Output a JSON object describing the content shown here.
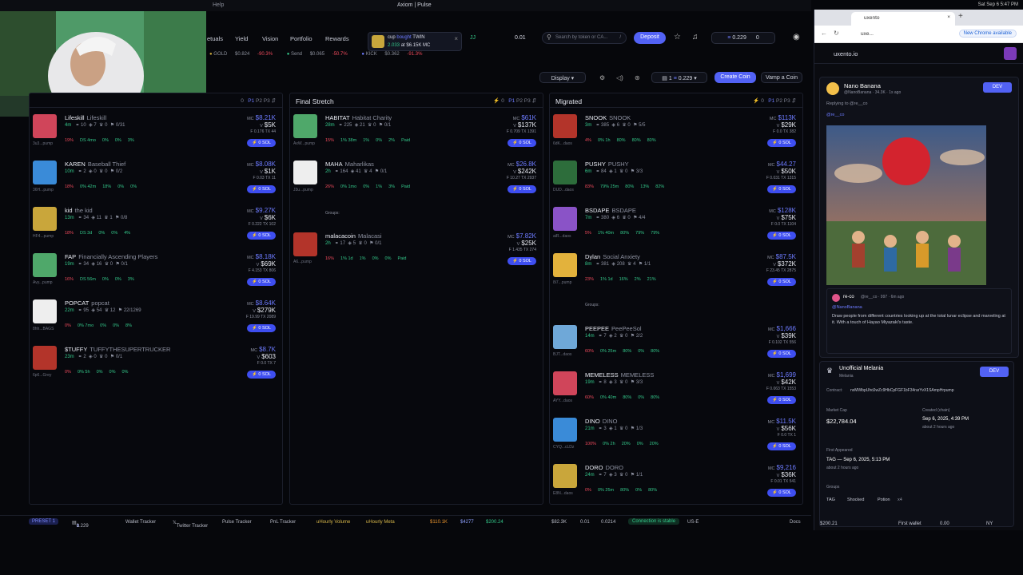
{
  "window": {
    "help": "Help",
    "title": "Axiom | Pulse"
  },
  "nav": {
    "links": [
      "etuals",
      "Yield",
      "Vision",
      "Portfolio",
      "Rewards"
    ],
    "notif": {
      "user": "cup",
      "action": "bought",
      "token": "TWIN",
      "amount": "2.033",
      "at": "at",
      "mc": "$6.15K MC"
    },
    "jj": "JJ",
    "jj_val": "0.01",
    "search_placeholder": "Search by token or CA...",
    "search_key": "/",
    "deposit": "Deposit",
    "wallet_val": "0.229",
    "wallet_count": "0"
  },
  "ticker": [
    {
      "name": "GOLD",
      "price": "$0.824",
      "chg": "-90.3%"
    },
    {
      "name": "Send",
      "price": "$0.065",
      "chg": "-50.7%"
    },
    {
      "name": "KICK",
      "price": "$0.362",
      "chg": "-91.3%"
    }
  ],
  "toolbar": {
    "display": "Display",
    "wallet_count": "1",
    "wallet_val": "0.229",
    "create": "Create Coin",
    "vamp": "Vamp a Coin"
  },
  "columns": {
    "left": {
      "filters": [
        "0",
        "P1",
        "P2",
        "P3"
      ],
      "items": [
        {
          "ticker": "Lifeskill",
          "name": "Lifeskill",
          "age": "4m",
          "holders": "10",
          "snipers": "7",
          "dev": "0",
          "ratio": "0/31",
          "mc": "$8.21K",
          "vol": "$5K",
          "f": "0.176",
          "tx": "44",
          "tag": "3u3...pump",
          "pcts": [
            "19%",
            "DS 4mo",
            "0%",
            "0%",
            "3%"
          ]
        },
        {
          "ticker": "KAREN",
          "name": "Baseball Thief",
          "age": "10m",
          "holders": "2",
          "snipers": "0",
          "dev": "0",
          "ratio": "0/2",
          "mc": "$8.08K",
          "vol": "$1K",
          "f": "0.03",
          "tx": "11",
          "tag": "36H...pump",
          "pcts": [
            "18%",
            "0% 42m",
            "18%",
            "0%",
            "0%"
          ]
        },
        {
          "ticker": "kid",
          "name": "the kid",
          "age": "13m",
          "holders": "34",
          "snipers": "11",
          "dev": "1",
          "ratio": "0/8",
          "mc": "$9.27K",
          "vol": "$6K",
          "f": "0.222",
          "tx": "102",
          "tag": "HF4...pump",
          "pcts": [
            "18%",
            "DS 3d",
            "0%",
            "0%",
            "4%"
          ]
        },
        {
          "ticker": "FAP",
          "name": "Financially Ascending Players",
          "age": "19m",
          "holders": "34",
          "snipers": "16",
          "dev": "0",
          "ratio": "0/1",
          "mc": "$8.18K",
          "vol": "$69K",
          "f": "4.153",
          "tx": "806",
          "tag": "Avy...pump",
          "pcts": [
            "16%",
            "DS 56m",
            "0%",
            "0%",
            "3%"
          ]
        },
        {
          "ticker": "POPCAT",
          "name": "popcat",
          "age": "22m",
          "holders": "95",
          "snipers": "54",
          "dev": "12",
          "ratio": "22/1269",
          "mc": "$8.64K",
          "vol": "$279K",
          "f": "19.99",
          "tx": "2089",
          "tag": "8hh...BAGS",
          "pcts": [
            "0%",
            "0% 7mo",
            "0%",
            "0%",
            "8%"
          ]
        },
        {
          "ticker": "$TUFFY",
          "name": "TUFFYTHESUPERTRUCKER",
          "age": "23m",
          "holders": "2",
          "snipers": "0",
          "dev": "0",
          "ratio": "0/1",
          "mc": "$8.7K",
          "vol": "$603",
          "f": "0.0",
          "tx": "7",
          "tag": "6p6...Grey",
          "pcts": [
            "0%",
            "0% 5h",
            "0%",
            "0%",
            "0%"
          ]
        }
      ]
    },
    "final": {
      "title": "Final Stretch",
      "filters": [
        "0",
        "P1",
        "P2",
        "P3"
      ],
      "groups": "Groups:",
      "items": [
        {
          "ticker": "HABITAT",
          "name": "Habitat Charity",
          "age": "28m",
          "holders": "225",
          "snipers": "21",
          "dev": "0",
          "ratio": "0/1",
          "mc": "$61K",
          "vol": "$137K",
          "f": "0.709",
          "tx": "1391",
          "tag": "AxW...pump",
          "pcts": [
            "15%",
            "1% 38m",
            "1%",
            "0%",
            "2%",
            "Paid"
          ]
        },
        {
          "ticker": "MAHA",
          "name": "Maharlikas",
          "age": "2h",
          "holders": "164",
          "snipers": "41",
          "dev": "4",
          "ratio": "0/1",
          "mc": "$26.8K",
          "vol": "$242K",
          "f": "10.27",
          "tx": "2937",
          "tag": "J3u...pump",
          "pcts": [
            "26%",
            "0% 1mo",
            "0%",
            "1%",
            "3%",
            "Paid"
          ]
        },
        {
          "ticker": "malacacoin",
          "name": "Malacasi",
          "age": "2h",
          "holders": "17",
          "snipers": "5",
          "dev": "0",
          "ratio": "0/1",
          "mc": "$7.82K",
          "vol": "$25K",
          "f": "1.435",
          "tx": "274",
          "tag": "A6...pump",
          "pcts": [
            "16%",
            "1% 1d",
            "1%",
            "0%",
            "0%",
            "Paid"
          ]
        }
      ]
    },
    "migrated": {
      "title": "Migrated",
      "filters": [
        "0",
        "P1",
        "P2",
        "P3"
      ],
      "groups": "Groups:",
      "items": [
        {
          "ticker": "SNOOK",
          "name": "SNOOK",
          "age": "3m",
          "holders": "385",
          "snipers": "6",
          "dev": "0",
          "ratio": "5/5",
          "mc": "$113K",
          "vol": "$29K",
          "f": "0.0",
          "tx": "382",
          "tag": "6dK...daos",
          "pcts": [
            "4%",
            "0% 1h",
            "80%",
            "80%",
            "80%"
          ]
        },
        {
          "ticker": "PUSHY",
          "name": "PUSHY",
          "age": "6m",
          "holders": "84",
          "snipers": "1",
          "dev": "0",
          "ratio": "3/3",
          "mc": "$44.27",
          "vol": "$50K",
          "f": "0.031",
          "tx": "1315",
          "tag": "DUD...daos",
          "pcts": [
            "83%",
            "79% 25m",
            "80%",
            "13%",
            "82%"
          ]
        },
        {
          "ticker": "BSDAPE",
          "name": "BSDAPE",
          "age": "7m",
          "holders": "380",
          "snipers": "6",
          "dev": "0",
          "ratio": "4/4",
          "mc": "$128K",
          "vol": "$75K",
          "f": "0.0",
          "tx": "1104",
          "tag": "aiR...daos",
          "pcts": [
            "5%",
            "1% 40m",
            "80%",
            "79%",
            "79%"
          ]
        },
        {
          "ticker": "Dylan",
          "name": "Social Anxiety",
          "age": "8m",
          "holders": "381",
          "snipers": "208",
          "dev": "4",
          "ratio": "1/1",
          "mc": "$87.5K",
          "vol": "$372K",
          "f": "23.45",
          "tx": "2875",
          "tag": "8i7...pump",
          "pcts": [
            "23%",
            "1% 1d",
            "16%",
            "2%",
            "21%"
          ]
        },
        {
          "ticker": "PEEPEE",
          "name": "PeePeeSol",
          "age": "14m",
          "holders": "7",
          "snipers": "2",
          "dev": "0",
          "ratio": "2/2",
          "mc": "$1,666",
          "vol": "$39K",
          "f": "0.102",
          "tx": "556",
          "tag": "BJT...daos",
          "pcts": [
            "60%",
            "0% 25m",
            "80%",
            "0%",
            "80%"
          ]
        },
        {
          "ticker": "MEMELESS",
          "name": "MEMELESS",
          "age": "19m",
          "holders": "8",
          "snipers": "3",
          "dev": "0",
          "ratio": "3/3",
          "mc": "$1,699",
          "vol": "$42K",
          "f": "0.063",
          "tx": "1553",
          "tag": "AYY...daos",
          "pcts": [
            "60%",
            "0% 40m",
            "80%",
            "0%",
            "80%"
          ]
        },
        {
          "ticker": "DINO",
          "name": "DINO",
          "age": "21m",
          "holders": "3",
          "snipers": "1",
          "dev": "0",
          "ratio": "1/3",
          "mc": "$11.5K",
          "vol": "$56K",
          "f": "0.0",
          "tx": "1",
          "tag": "CYQ...cLDz",
          "pcts": [
            "100%",
            "0% 2h",
            "20%",
            "0%",
            "20%"
          ]
        },
        {
          "ticker": "DORO",
          "name": "DORO",
          "age": "24m",
          "holders": "7",
          "snipers": "3",
          "dev": "0",
          "ratio": "1/1",
          "mc": "$9,216",
          "vol": "$36K",
          "f": "0.01",
          "tx": "541",
          "tag": "E8N...daos",
          "pcts": [
            "0%",
            "0% 25m",
            "80%",
            "0%",
            "80%"
          ]
        }
      ]
    }
  },
  "bottombar": {
    "preset": "PRESET 1",
    "wallets": "1",
    "wallet_val": "0.229",
    "wallet_tracker": "Wallet Tracker",
    "twitter": "Twitter Tracker",
    "pulse": "Pulse Tracker",
    "pnl": "PnL Tracker",
    "hourly_vol": "uHourly Volume",
    "hourly_meta": "uHourly Meta",
    "btc": "$110.1K",
    "eth": "$4277",
    "sol": "$200.24",
    "s1": "$82.3K",
    "s2": "0.01",
    "s3": "0.0214",
    "conn": "Connection is stable",
    "region": "US-E",
    "docs": "Docs"
  },
  "browser": {
    "tab": "uxento",
    "url": "uxe...",
    "chrome_btn": "New Chrome available",
    "site": "uxento.io",
    "post": {
      "author": "Nano Banana",
      "handle": "@NanoBanana · 34.3K · 1s ago",
      "reply": "Replying to @re__co",
      "reply_user": "@re__co",
      "quoted_author": "re-co",
      "quoted_handle": "@re__co · 997 · 6m ago",
      "quoted_mention": "@NanoBanana",
      "quoted_text": "Draw people from different countries looking up at the total lunar eclipse and marveling at it. With a touch of Hayao Miyazaki's taste.",
      "dev": "DEV"
    },
    "coin": {
      "name": "Unofficial Melania",
      "sub": "Melania",
      "contract_label": "Contract:",
      "contract": "nxMWbpUhdJwZc9HbCpFGF1bF34rarYvX1SAmpHrpump",
      "mc_label": "Market Cap",
      "mc": "$22,784.04",
      "created_label": "Created (chain)",
      "created": "Sep 6, 2025, 4:39 PM",
      "created_ago": "about 2 hours ago",
      "first_label": "First Appeared",
      "first": "TAG — Sep 6, 2025, 5:13 PM",
      "first_ago": "about 2 hours ago",
      "groups_label": "Groups",
      "groups": [
        "TAG",
        "Shocked",
        "Potion",
        "x4"
      ],
      "dev": "DEV"
    },
    "footer": {
      "bal": "$200.21",
      "wallet": "First wallet",
      "wallet_val": "0.00",
      "region": "NY"
    },
    "clock": "Sat Sep 6 5:47 PM"
  }
}
